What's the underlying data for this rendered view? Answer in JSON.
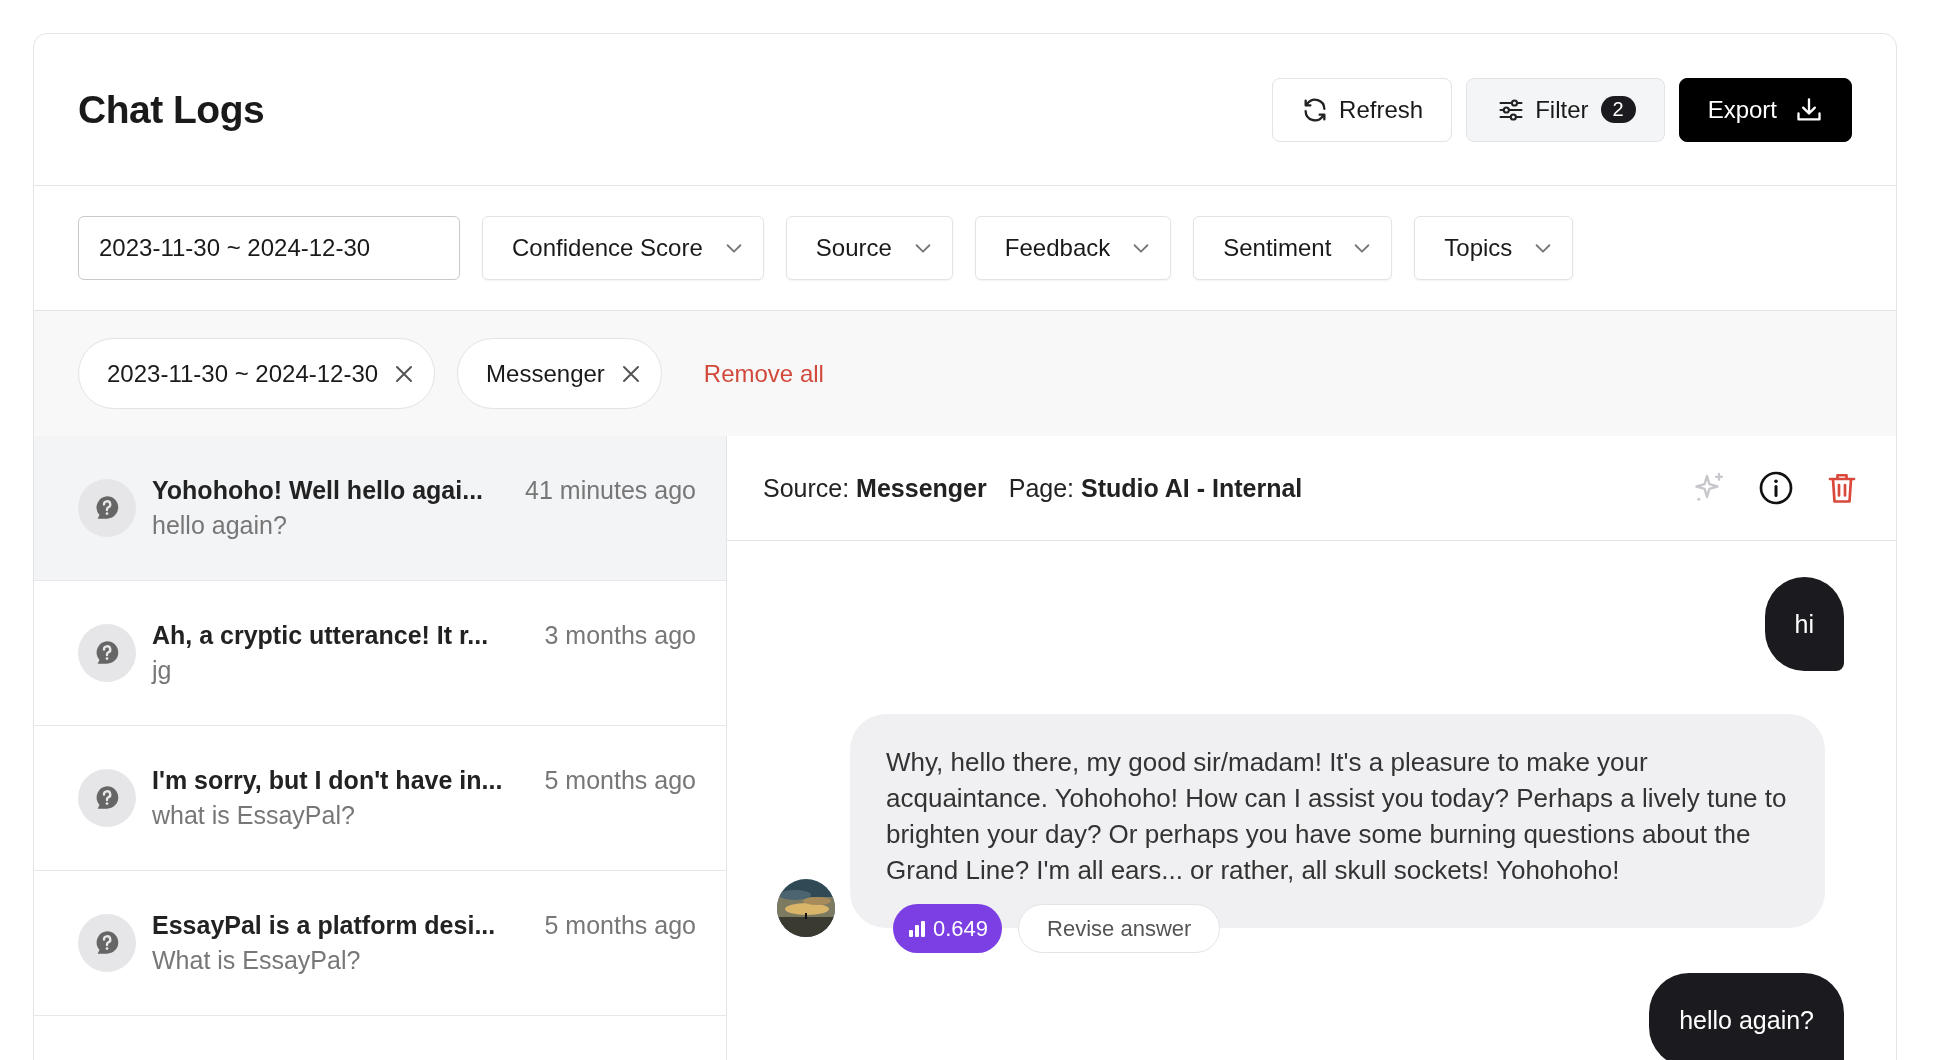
{
  "header": {
    "title": "Chat Logs",
    "buttons": [
      {
        "kind": "refresh",
        "label": "Refresh"
      },
      {
        "kind": "filter",
        "label": "Filter",
        "badge": "2"
      },
      {
        "kind": "export",
        "label": "Export"
      }
    ]
  },
  "filters": {
    "date_range": {
      "value": "2023-11-30 ~ 2024-12-30"
    },
    "dropdowns": [
      {
        "label": "Confidence Score"
      },
      {
        "label": "Source"
      },
      {
        "label": "Feedback"
      },
      {
        "label": "Sentiment"
      },
      {
        "label": "Topics"
      }
    ]
  },
  "active_filters": {
    "chips": [
      {
        "label": "2023-11-30 ~ 2024-12-30"
      },
      {
        "label": "Messenger"
      }
    ],
    "remove_all": "Remove all"
  },
  "conversations": [
    {
      "title": "Yohohoho! Well hello agai...",
      "time": "41 minutes ago",
      "preview": "hello again?",
      "selected": true
    },
    {
      "title": "Ah, a cryptic utterance! It r...",
      "time": "3 months ago",
      "preview": "jg",
      "selected": false
    },
    {
      "title": "I'm sorry, but I don't have in...",
      "time": "5 months ago",
      "preview": "what is EssayPal?",
      "selected": false
    },
    {
      "title": "EssayPal is a platform desi...",
      "time": "5 months ago",
      "preview": "What is EssayPal?",
      "selected": false
    }
  ],
  "detail": {
    "source": "Source: **Messenger**",
    "page": "Page: **Studio AI - Internal**",
    "messages": [
      {
        "kind": "user",
        "text": "hi"
      },
      {
        "kind": "bot",
        "text": "Why, hello there, my good sir/madam! It's a pleasure to make your acquaintance. Yohohoho! How can I assist you today? Perhaps a lively tune to brighten your day? Or perhaps you have some burning questions about the Grand Line? I'm all ears... or rather, all skull sockets! Yohohoho!",
        "score": "0.649",
        "action": "Revise answer"
      },
      {
        "kind": "user",
        "text": "hello again?"
      }
    ]
  }
}
